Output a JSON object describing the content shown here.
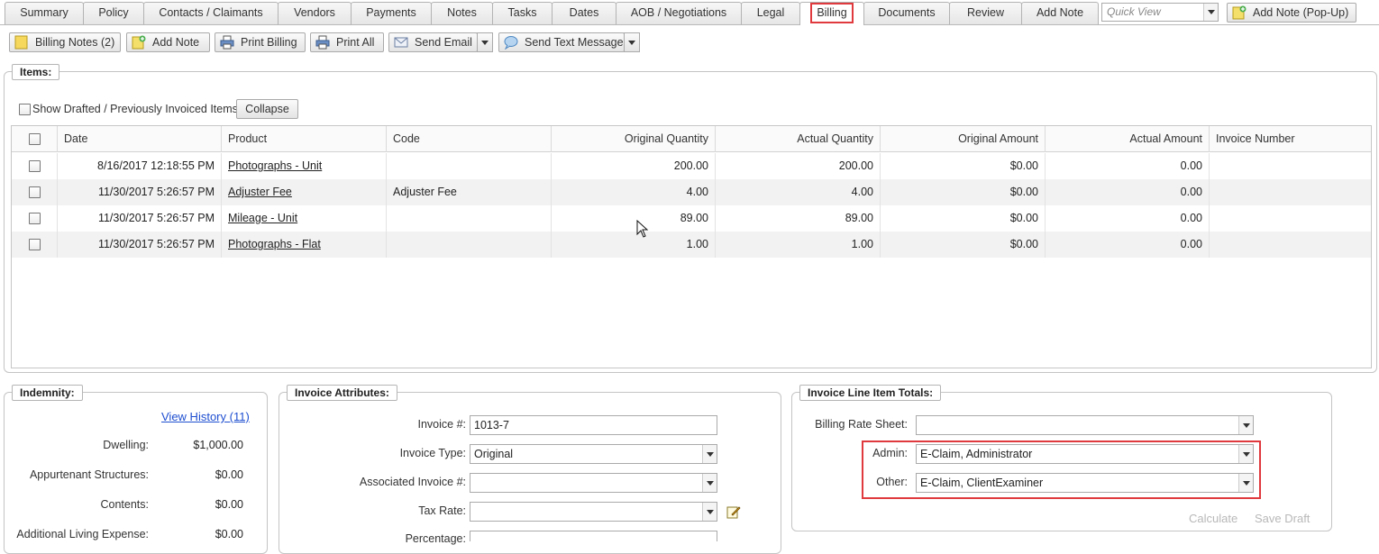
{
  "tabs": [
    "Summary",
    "Policy",
    "Contacts / Claimants",
    "Vendors",
    "Payments",
    "Notes",
    "Tasks",
    "Dates",
    "AOB / Negotiations",
    "Legal",
    "Billing",
    "Documents",
    "Review",
    "Add Note"
  ],
  "active_tab": "Billing",
  "quick_view_placeholder": "Quick View",
  "add_note_popup_label": "Add Note (Pop-Up)",
  "toolbar": {
    "billing_notes": "Billing Notes (2)",
    "add_note": "Add Note",
    "print_billing": "Print Billing",
    "print_all": "Print All",
    "send_email": "Send Email",
    "send_text": "Send Text Message"
  },
  "items": {
    "legend": "Items:",
    "show_drafted_label": "Show Drafted / Previously Invoiced Items",
    "collapse_label": "Collapse",
    "columns": [
      "Date",
      "Product",
      "Code",
      "Original Quantity",
      "Actual Quantity",
      "Original Amount",
      "Actual Amount",
      "Invoice Number"
    ],
    "rows": [
      {
        "date": "8/16/2017 12:18:55 PM",
        "product": "Photographs - Unit",
        "code": "",
        "orig_qty": "200.00",
        "actual_qty": "200.00",
        "orig_amt": "$0.00",
        "actual_amt": "0.00",
        "invoice": ""
      },
      {
        "date": "11/30/2017 5:26:57 PM",
        "product": "Adjuster Fee",
        "code": "Adjuster Fee",
        "orig_qty": "4.00",
        "actual_qty": "4.00",
        "orig_amt": "$0.00",
        "actual_amt": "0.00",
        "invoice": ""
      },
      {
        "date": "11/30/2017 5:26:57 PM",
        "product": "Mileage - Unit",
        "code": "",
        "orig_qty": "89.00",
        "actual_qty": "89.00",
        "orig_amt": "$0.00",
        "actual_amt": "0.00",
        "invoice": ""
      },
      {
        "date": "11/30/2017 5:26:57 PM",
        "product": "Photographs - Flat",
        "code": "",
        "orig_qty": "1.00",
        "actual_qty": "1.00",
        "orig_amt": "$0.00",
        "actual_amt": "0.00",
        "invoice": ""
      }
    ]
  },
  "indemnity": {
    "legend": "Indemnity:",
    "view_history": "View History (11)",
    "lines": [
      {
        "label": "Dwelling:",
        "value": "$1,000.00"
      },
      {
        "label": "Appurtenant Structures:",
        "value": "$0.00"
      },
      {
        "label": "Contents:",
        "value": "$0.00"
      },
      {
        "label": "Additional Living Expense:",
        "value": "$0.00"
      }
    ]
  },
  "invoice_attributes": {
    "legend": "Invoice Attributes:",
    "invoice_no_label": "Invoice #:",
    "invoice_no_value": "1013-7",
    "invoice_type_label": "Invoice Type:",
    "invoice_type_value": "Original",
    "associated_label": "Associated Invoice #:",
    "associated_value": "",
    "tax_rate_label": "Tax Rate:",
    "tax_rate_value": "",
    "percentage_label": "Percentage:"
  },
  "totals": {
    "legend": "Invoice Line Item Totals:",
    "rate_sheet_label": "Billing Rate Sheet:",
    "rate_sheet_value": "",
    "admin_label": "Admin:",
    "admin_value": "E-Claim, Administrator",
    "other_label": "Other:",
    "other_value": "E-Claim, ClientExaminer",
    "calculate": "Calculate",
    "save_draft": "Save Draft"
  },
  "colors": {
    "highlight": "#e0393e",
    "link": "#1f4fd1"
  }
}
